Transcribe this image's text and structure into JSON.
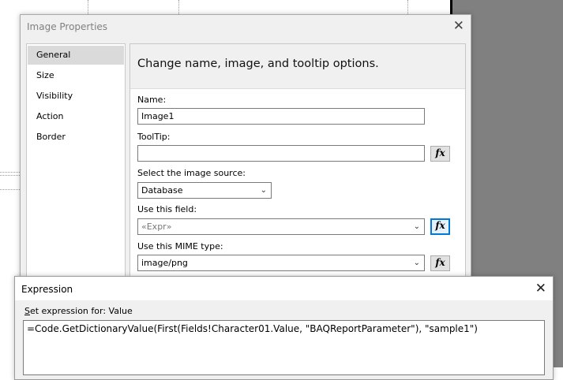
{
  "image_properties": {
    "title": "Image Properties",
    "close_glyph": "✕",
    "nav_items": [
      "General",
      "Size",
      "Visibility",
      "Action",
      "Border"
    ],
    "selected_nav": "General",
    "header": "Change name, image, and tooltip options.",
    "name_label": "Name:",
    "name_value": "Image1",
    "tooltip_label": "ToolTip:",
    "tooltip_value": "",
    "source_label": "Select the image source:",
    "source_value": "Database",
    "field_label": "Use this field:",
    "field_value": "«Expr»",
    "mime_label": "Use this MIME type:",
    "mime_value": "image/png",
    "fx_label": "fx"
  },
  "expression": {
    "title": "Expression",
    "close_glyph": "✕",
    "set_label_accel": "S",
    "set_label_rest": "et expression for: Value",
    "expression_text": "=Code.GetDictionaryValue(First(Fields!Character01.Value, \"BAQReportParameter\"), \"sample1\")"
  },
  "icons": {
    "dropdown": "chevron-down-icon",
    "close": "close-icon",
    "function": "function-fx-icon"
  },
  "colors": {
    "focus_accent": "#0078d7",
    "selected_nav_bg": "#dadada"
  }
}
